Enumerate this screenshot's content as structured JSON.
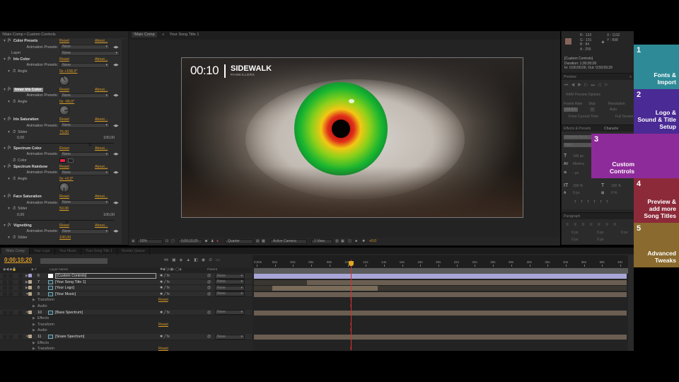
{
  "effect_controls": {
    "header": "!Main Comp • Custom Controls",
    "effects": [
      {
        "name": "Color Presets",
        "reset": "Reset",
        "about": "About...",
        "presets_label": "Animation Presets:",
        "presets_value": "None",
        "extra_label": "Layer",
        "extra_value": "None"
      },
      {
        "name": "Iris Color",
        "reset": "Reset",
        "about": "About...",
        "presets_label": "Animation Presets:",
        "presets_value": "None",
        "param": "Angle",
        "value": "0x +158,0°",
        "angle_deg": 158
      },
      {
        "name": "Inner Iris Color",
        "selected": true,
        "reset": "Reset",
        "about": "About...",
        "presets_label": "Animation Presets:",
        "presets_value": "None",
        "param": "Angle",
        "value": "0x -99,0°",
        "angle_deg": -99
      },
      {
        "name": "Iris Saturation",
        "reset": "Reset",
        "about": "About...",
        "presets_label": "Animation Presets:",
        "presets_value": "None",
        "param": "Slider",
        "value": "75,00",
        "min": "0,00",
        "max": "100,00",
        "slider_value": 75
      },
      {
        "name": "Spectrum Color",
        "reset": "Reset",
        "about": "About...",
        "presets_label": "Animation Presets:",
        "presets_value": "None",
        "param": "Color",
        "color": "#e8224a"
      },
      {
        "name": "Spectrum Rainbow",
        "reset": "Reset",
        "about": "About...",
        "presets_label": "Animation Presets:",
        "presets_value": "None",
        "param": "Angle",
        "value": "0x +0,0°",
        "angle_deg": 0
      },
      {
        "name": "Face Saturation",
        "reset": "Reset",
        "about": "About...",
        "presets_label": "Animation Presets:",
        "presets_value": "None",
        "param": "Slider",
        "value": "50,00",
        "min": "0,00",
        "max": "100,00",
        "slider_value": 50
      },
      {
        "name": "Vignetting",
        "reset": "Reset",
        "about": "About...",
        "presets_label": "Animation Presets:",
        "presets_value": "None",
        "param": "Slider",
        "value": "100,00"
      }
    ]
  },
  "composition": {
    "tabs": [
      "!Main Comp",
      "Your Song Title 1"
    ],
    "tab_separator": "«",
    "overlay": {
      "time": "00:10",
      "title": "SIDEWALK",
      "subtitle": "PAINKILLERS"
    },
    "toolbar": {
      "zoom": "50%",
      "timecode": "0;00;10;20",
      "resolution": "Quarter",
      "camera": "Active Camera",
      "views": "1 View",
      "exposure": "+0,0"
    }
  },
  "info_panel": {
    "r": "R : 133",
    "g": "G : 101",
    "b": "B : 84",
    "a": "A : 255",
    "x": "X : 1132",
    "y": "Y : 898",
    "sample_color": "#85655a",
    "layer": "[Custom Controls]",
    "duration": "Duration: 1;00;00;00",
    "inout": "In: 0;00;00;00, Out: 0;59;59;29"
  },
  "preview_panel": {
    "title": "Preview",
    "ram_options": "RAM Preview Options",
    "frame_rate_label": "Frame Rate",
    "skip_label": "Skip",
    "resolution_label": "Resolution",
    "frame_rate": "(29.97)",
    "skip": "0",
    "resolution": "Auto",
    "from_current": "From Current Time",
    "full_screen": "Full Screen"
  },
  "character_panel": {
    "tabs": [
      "Effects & Presets",
      "Characte"
    ],
    "font": "Proxima Nova",
    "style": "Bold",
    "size": "146 px",
    "leading": "Metrics",
    "tracking": "- px",
    "vscale": "100 %",
    "hscale": "100 %",
    "baseline": "0 px",
    "tsume": "0 %"
  },
  "paragraph_panel": {
    "title": "Paragraph",
    "indent1": "0 px",
    "indent2": "0 px",
    "indent3": "0 px",
    "space1": "0 px",
    "space2": "0 px"
  },
  "tutorial_tabs": [
    {
      "number": "1",
      "label": "Fonts & Import",
      "color": "#2e8a96"
    },
    {
      "number": "2",
      "label": "Logo & Sound & Title Setup",
      "color": "#4a2a94"
    },
    {
      "number": "3",
      "label": "Custom Controls",
      "color": "#8e2b9a"
    },
    {
      "number": "4",
      "label": "Preview & add more Song Titles",
      "color": "#8c2a3a"
    },
    {
      "number": "5",
      "label": "Advanced Tweaks",
      "color": "#8a6a2e"
    }
  ],
  "timeline": {
    "tabs": [
      "!Main Comp",
      "Your Logo",
      "Your Music",
      "Your Song Title 1",
      "Render Queue"
    ],
    "timecode": "0;00;10;20",
    "layer_name_header": "Layer Name",
    "parent_header": "Parent",
    "layers": [
      {
        "num": "6",
        "name": "[Custom Controls]",
        "label_color": "lavender",
        "parent": "None",
        "selected": true
      },
      {
        "num": "7",
        "name": "[Your Song Title 1]",
        "parent": "None"
      },
      {
        "num": "8",
        "name": "[Your Logo]",
        "parent": "None"
      },
      {
        "num": "9",
        "name": "[Your Music]",
        "parent": "None",
        "expanded": true,
        "props": [
          "Transform",
          "Audio"
        ]
      },
      {
        "num": "10",
        "name": "[Bass Spectrum]",
        "parent": "None",
        "expanded": true,
        "props": [
          "Effects",
          "Transform",
          "Audio"
        ]
      },
      {
        "num": "11",
        "name": "[Snare Spectrum]",
        "parent": "None",
        "expanded": true,
        "props": [
          "Effects",
          "Transform"
        ]
      }
    ],
    "reset_label": "Reset",
    "ruler": [
      "0;00s",
      "02s",
      "04s",
      "06s",
      "08s",
      "10s",
      "12s",
      "14s",
      "16s",
      "18s",
      "20s",
      "22s",
      "24s",
      "26s",
      "28s",
      "30s",
      "32s",
      "34s",
      "36s",
      "38s",
      "40s"
    ],
    "current_time_seconds": 10.67,
    "visible_duration_seconds": 41
  }
}
